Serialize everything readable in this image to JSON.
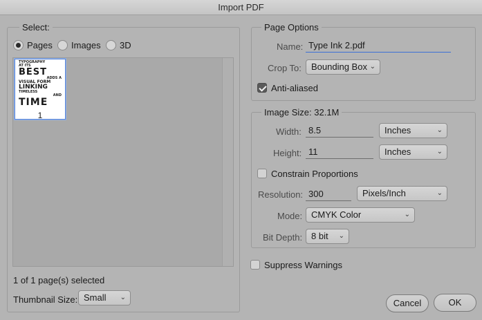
{
  "window": {
    "title": "Import PDF"
  },
  "select_panel": {
    "heading": "Select:",
    "radios": [
      {
        "label": "Pages",
        "selected": true
      },
      {
        "label": "Images",
        "selected": false
      },
      {
        "label": "3D",
        "selected": false
      }
    ],
    "thumbnails": [
      {
        "page_number": "1"
      }
    ],
    "thumbnail_text": [
      "TYPOGRAPHY",
      "AT ITS",
      "BEST",
      "ADDS A",
      "VISUAL FORM",
      "LINKING",
      "TIMELESS",
      "AND",
      "TIME"
    ],
    "status": "1 of 1 page(s) selected",
    "thumbnail_size_label": "Thumbnail Size:",
    "thumbnail_size_value": "Small"
  },
  "page_options": {
    "heading": "Page Options",
    "name_label": "Name:",
    "name_value": "Type Ink 2.pdf",
    "crop_label": "Crop To:",
    "crop_value": "Bounding Box",
    "anti_aliased_label": "Anti-aliased",
    "anti_aliased_checked": true
  },
  "image_size": {
    "heading": "Image Size: 32.1M",
    "width_label": "Width:",
    "width_value": "8.5",
    "width_unit": "Inches",
    "height_label": "Height:",
    "height_value": "11",
    "height_unit": "Inches",
    "constrain_label": "Constrain Proportions",
    "constrain_checked": false,
    "resolution_label": "Resolution:",
    "resolution_value": "300",
    "resolution_unit": "Pixels/Inch",
    "mode_label": "Mode:",
    "mode_value": "CMYK Color",
    "bit_depth_label": "Bit Depth:",
    "bit_depth_value": "8 bit"
  },
  "suppress_warnings_label": "Suppress Warnings",
  "suppress_warnings_checked": false,
  "buttons": {
    "cancel": "Cancel",
    "ok": "OK"
  },
  "icons": {
    "dropdown": "chevron-down-icon",
    "check": "checkmark-icon"
  },
  "colors": {
    "background": "#b4b4b4",
    "focus": "#3b6fd6",
    "thumb_border": "#5b86d6"
  }
}
